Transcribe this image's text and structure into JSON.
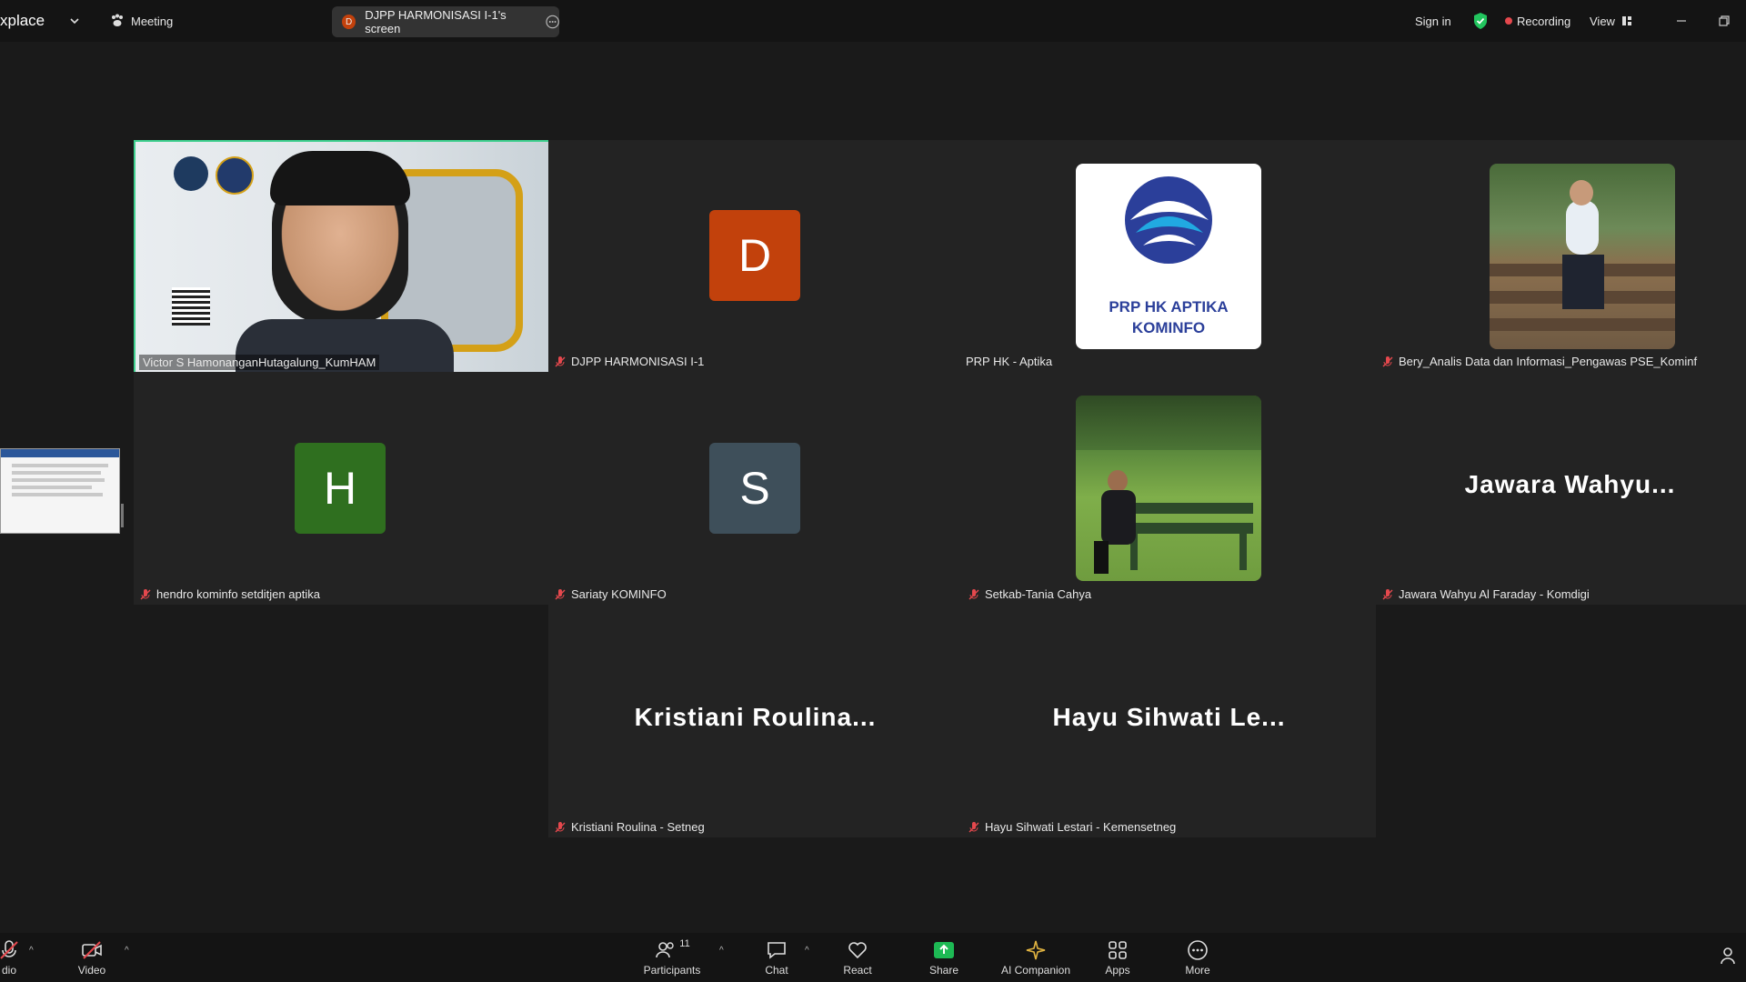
{
  "topbar": {
    "app_label": "xplace",
    "meeting_label": "Meeting",
    "share_avatar_letter": "D",
    "share_label": "DJPP HARMONISASI I-1's screen",
    "sign_in": "Sign in",
    "recording": "Recording",
    "view": "View"
  },
  "colors": {
    "speaker_border": "#3ecf8e",
    "avatar_d": "#c2410c",
    "avatar_h": "#2f6f1f",
    "avatar_s": "#3e4f5a",
    "mic_off": "#e5484d",
    "recording_dot": "#e5484d",
    "share_green": "#1db954"
  },
  "participants": [
    {
      "name": "Victor S HamonanganHutagalung_KumHAM",
      "video": "camera",
      "active_speaker": true
    },
    {
      "name": "DJPP HARMONISASI I-1",
      "avatar_letter": "D"
    },
    {
      "name": "PRP HK - Aptika",
      "logo_line1": "PRP HK APTIKA",
      "logo_line2": "KOMINFO"
    },
    {
      "name": "Bery_Analis Data dan Informasi_Pengawas PSE_Kominf",
      "video": "profile-photo"
    },
    {
      "name": "hendro kominfo setditjen aptika",
      "avatar_letter": "H"
    },
    {
      "name": "Sariaty KOMINFO",
      "avatar_letter": "S"
    },
    {
      "name": "Setkab-Tania Cahya",
      "video": "profile-photo"
    },
    {
      "name": "Jawara Wahyu Al Faraday - Komdigi",
      "display_name": "Jawara Wahyu..."
    },
    {
      "name": "Kristiani Roulina - Setneg",
      "display_name": "Kristiani Roulina..."
    },
    {
      "name": "Hayu Sihwati Lestari - Kemensetneg",
      "display_name": "Hayu Sihwati Le..."
    }
  ],
  "toolbar": {
    "audio": "dio",
    "video": "Video",
    "participants": "Participants",
    "participants_count": "11",
    "chat": "Chat",
    "react": "React",
    "share": "Share",
    "ai": "AI Companion",
    "apps": "Apps",
    "more": "More"
  }
}
